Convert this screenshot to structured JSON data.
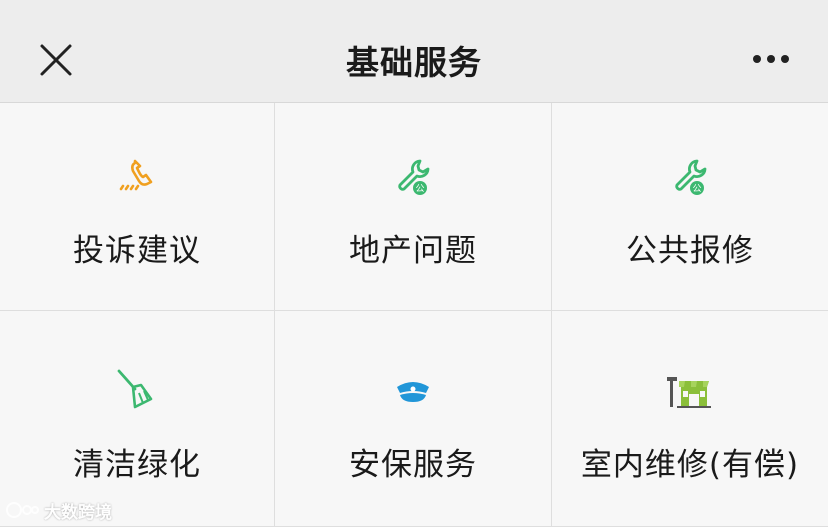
{
  "header": {
    "title": "基础服务",
    "close_icon": "close-icon",
    "more_icon": "more-horizontal-icon"
  },
  "grid": {
    "items": [
      {
        "label": "投诉建议",
        "icon": "phone-call-icon",
        "color": "#f0a020"
      },
      {
        "label": "地产问题",
        "icon": "wrench-public-icon",
        "color": "#3cb870"
      },
      {
        "label": "公共报修",
        "icon": "wrench-public-icon",
        "color": "#3cb870"
      },
      {
        "label": "清洁绿化",
        "icon": "broom-icon",
        "color": "#3cb870"
      },
      {
        "label": "安保服务",
        "icon": "security-cap-icon",
        "color": "#2196d8"
      },
      {
        "label": "室内维修(有偿)",
        "icon": "shop-repair-icon",
        "color": "#8bbf3a"
      }
    ]
  },
  "watermark": {
    "text": "大数跨境"
  }
}
